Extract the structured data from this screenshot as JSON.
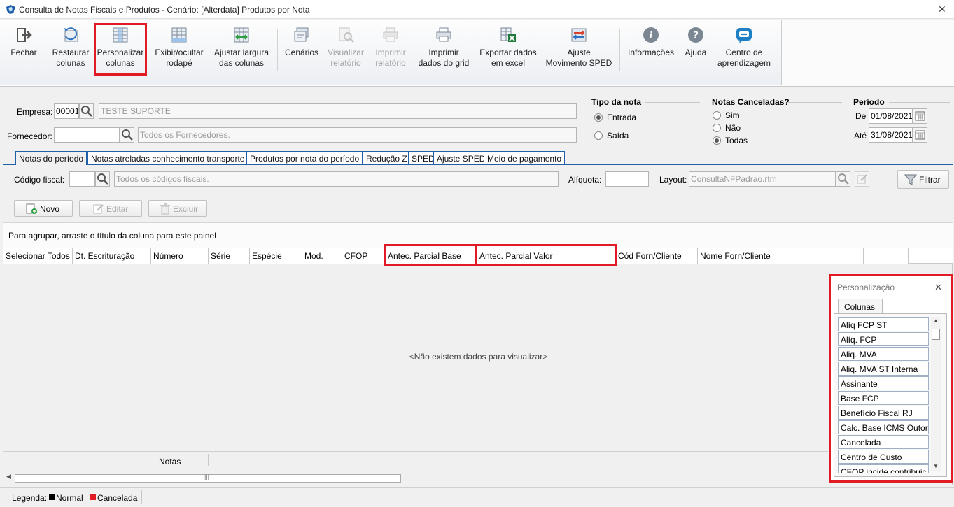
{
  "window": {
    "title": "Consulta de Notas Fiscais e Produtos - Cenário: [Alterdata] Produtos por Nota",
    "close": "✕"
  },
  "ribbon": {
    "fechar": "Fechar",
    "restaurar": [
      "Restaurar",
      "colunas"
    ],
    "personalizar": [
      "Personalizar",
      "colunas"
    ],
    "exibir": [
      "Exibir/ocultar",
      "rodapé"
    ],
    "ajustar": [
      "Ajustar largura",
      "das colunas"
    ],
    "cenarios": "Cenários",
    "visualizar": [
      "Visualizar",
      "relatório"
    ],
    "imprimir_rel": [
      "Imprimir",
      "relatório"
    ],
    "imprimir_grid": [
      "Imprimir",
      "dados do grid"
    ],
    "exportar": [
      "Exportar dados",
      "em excel"
    ],
    "ajuste_sped": [
      "Ajuste",
      "Movimento SPED"
    ],
    "informacoes": "Informações",
    "ajuda": "Ajuda",
    "centro": [
      "Centro de",
      "aprendizagem"
    ]
  },
  "filters": {
    "empresa_label": "Empresa:",
    "empresa_code": "00001",
    "empresa_name": "TESTE SUPORTE",
    "fornecedor_label": "Fornecedor:",
    "fornecedor_placeholder": "Todos os Fornecedores.",
    "tipo_title": "Tipo da nota",
    "entrada": "Entrada",
    "saida": "Saída",
    "canceladas_title": "Notas Canceladas?",
    "sim": "Sim",
    "nao": "Não",
    "todas": "Todas",
    "periodo_title": "Período",
    "de_label": "De",
    "de_value": "01/08/2021",
    "ate_label": "Até",
    "ate_value": "31/08/2021"
  },
  "tabs": [
    "Notas do período",
    "Notas atreladas conhecimento transporte",
    "Produtos por nota do período",
    "Redução Z",
    "SPED",
    "Ajuste SPED",
    "Meio de pagamento"
  ],
  "panel": {
    "codigo_label": "Código fiscal:",
    "codigo_placeholder": "Todos os códigos fiscais.",
    "aliquota_label": "Alíquota:",
    "layout_label": "Layout:",
    "layout_value": "ConsultaNFPadrao.rtm",
    "filtrar": "Filtrar",
    "novo": "Novo",
    "editar": "Editar",
    "excluir": "Excluir",
    "group_hint": "Para agrupar, arraste o título da coluna para este painel"
  },
  "grid": {
    "columns": [
      "Selecionar Todos",
      "Dt. Escrituração",
      "Número",
      "Série",
      "Espécie",
      "Mod.",
      "CFOP",
      "Antec. Parcial Base",
      "Antec. Parcial Valor",
      "Cód Forn/Cliente",
      "Nome Forn/Cliente"
    ],
    "empty": "<Não existem dados para visualizar>",
    "footer": "Notas"
  },
  "legend": {
    "label": "Legenda:",
    "normal": "Normal",
    "cancelada": "Cancelada",
    "normal_color": "#000000",
    "cancelada_color": "#e01b24"
  },
  "personalizacao": {
    "title": "Personalização",
    "tab": "Colunas",
    "items": [
      "Alíq FCP ST",
      "Alíq. FCP",
      "Aliq. MVA",
      "Aliq. MVA ST Interna",
      "Assinante",
      "Base FCP",
      "Benefício Fiscal RJ",
      "Calc. Base ICMS Outorg",
      "Cancelada",
      "Centro de Custo",
      "CFOP incide contribuiç"
    ]
  },
  "colors": {
    "highlight": "#e01b24",
    "tab_border": "#1e5fa8"
  }
}
